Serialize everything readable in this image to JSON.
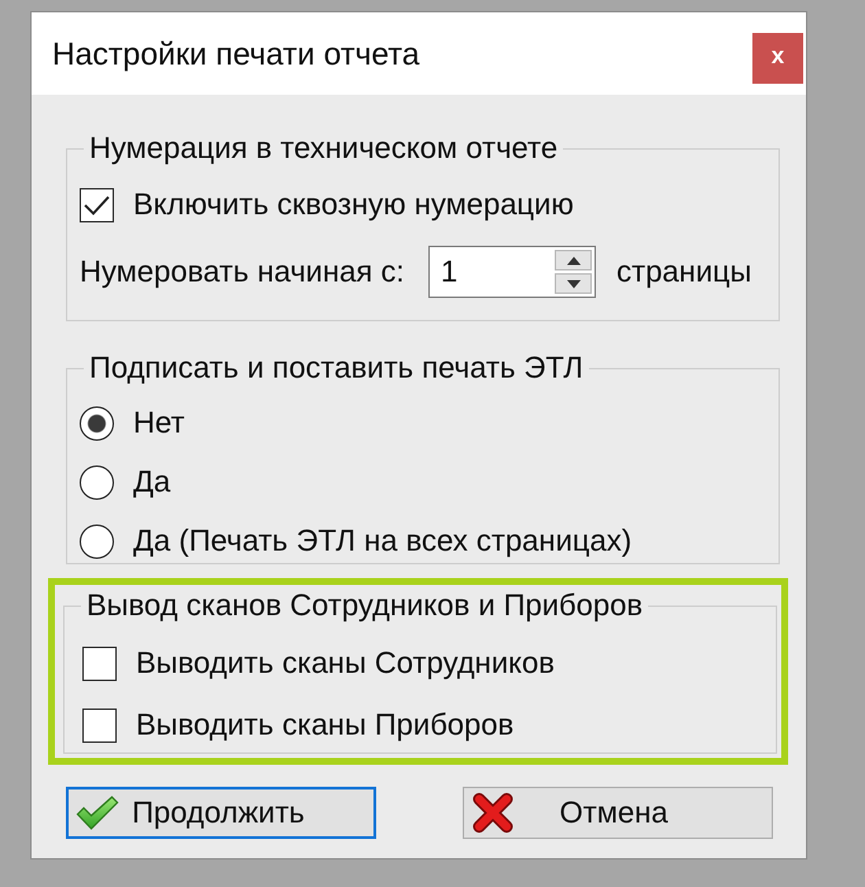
{
  "window": {
    "title": "Настройки печати отчета",
    "close_button": "x"
  },
  "numbering_group": {
    "legend": "Нумерация в техническом отчете",
    "checkbox": {
      "label": "Включить сквозную нумерацию",
      "checked": true
    },
    "start_label": "Нумеровать начиная с:",
    "start_value": "1",
    "unit": "страницы"
  },
  "signature_group": {
    "legend": "Подписать и поставить печать ЭТЛ",
    "options": [
      {
        "label": "Нет",
        "selected": true
      },
      {
        "label": "Да",
        "selected": false
      },
      {
        "label": "Да (Печать ЭТЛ на всех страницах)",
        "selected": false
      }
    ]
  },
  "scans_group": {
    "legend": "Вывод сканов Сотрудников и Приборов",
    "highlighted": true,
    "checkboxes": [
      {
        "label": "Выводить сканы Сотрудников",
        "checked": false
      },
      {
        "label": "Выводить сканы Приборов",
        "checked": false
      }
    ]
  },
  "buttons": [
    {
      "kind": "confirm",
      "label": "Продолжить",
      "default": true
    },
    {
      "kind": "cancel",
      "label": "Отмена",
      "default": false
    }
  ]
}
